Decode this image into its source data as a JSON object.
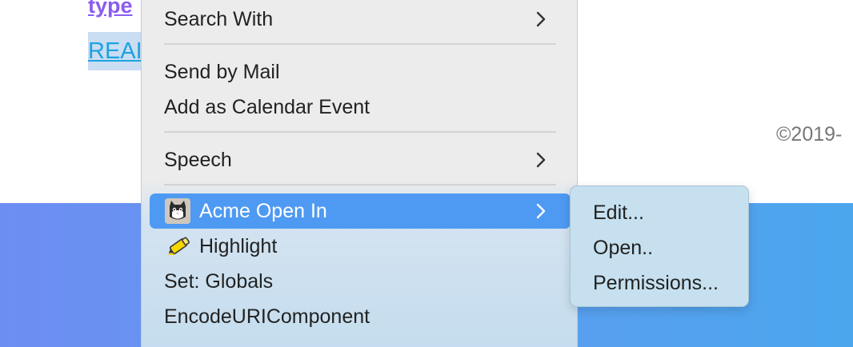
{
  "page": {
    "link_top": "type",
    "link_selected": "REAI",
    "copyright": "©2019-"
  },
  "context_menu": {
    "items": [
      {
        "label": "Search With",
        "has_submenu": true
      },
      {
        "label": "Send by Mail",
        "has_submenu": false
      },
      {
        "label": "Add as Calendar Event",
        "has_submenu": false
      },
      {
        "label": "Speech",
        "has_submenu": true
      },
      {
        "label": "Acme Open In",
        "has_submenu": true,
        "icon": "cat-app-icon",
        "selected": true
      },
      {
        "label": "Highlight",
        "has_submenu": false,
        "icon": "highlighter-icon"
      },
      {
        "label": "Set: Globals",
        "has_submenu": false
      },
      {
        "label": "EncodeURIComponent",
        "has_submenu": false
      }
    ]
  },
  "submenu": {
    "items": [
      {
        "label": "Edit..."
      },
      {
        "label": "Open.."
      },
      {
        "label": "Permissions..."
      }
    ]
  },
  "colors": {
    "selection": "#4e9af3",
    "menu_background": "#ececec",
    "link_purple": "#8a5cf0",
    "link_cyan": "#1ca3e0"
  }
}
